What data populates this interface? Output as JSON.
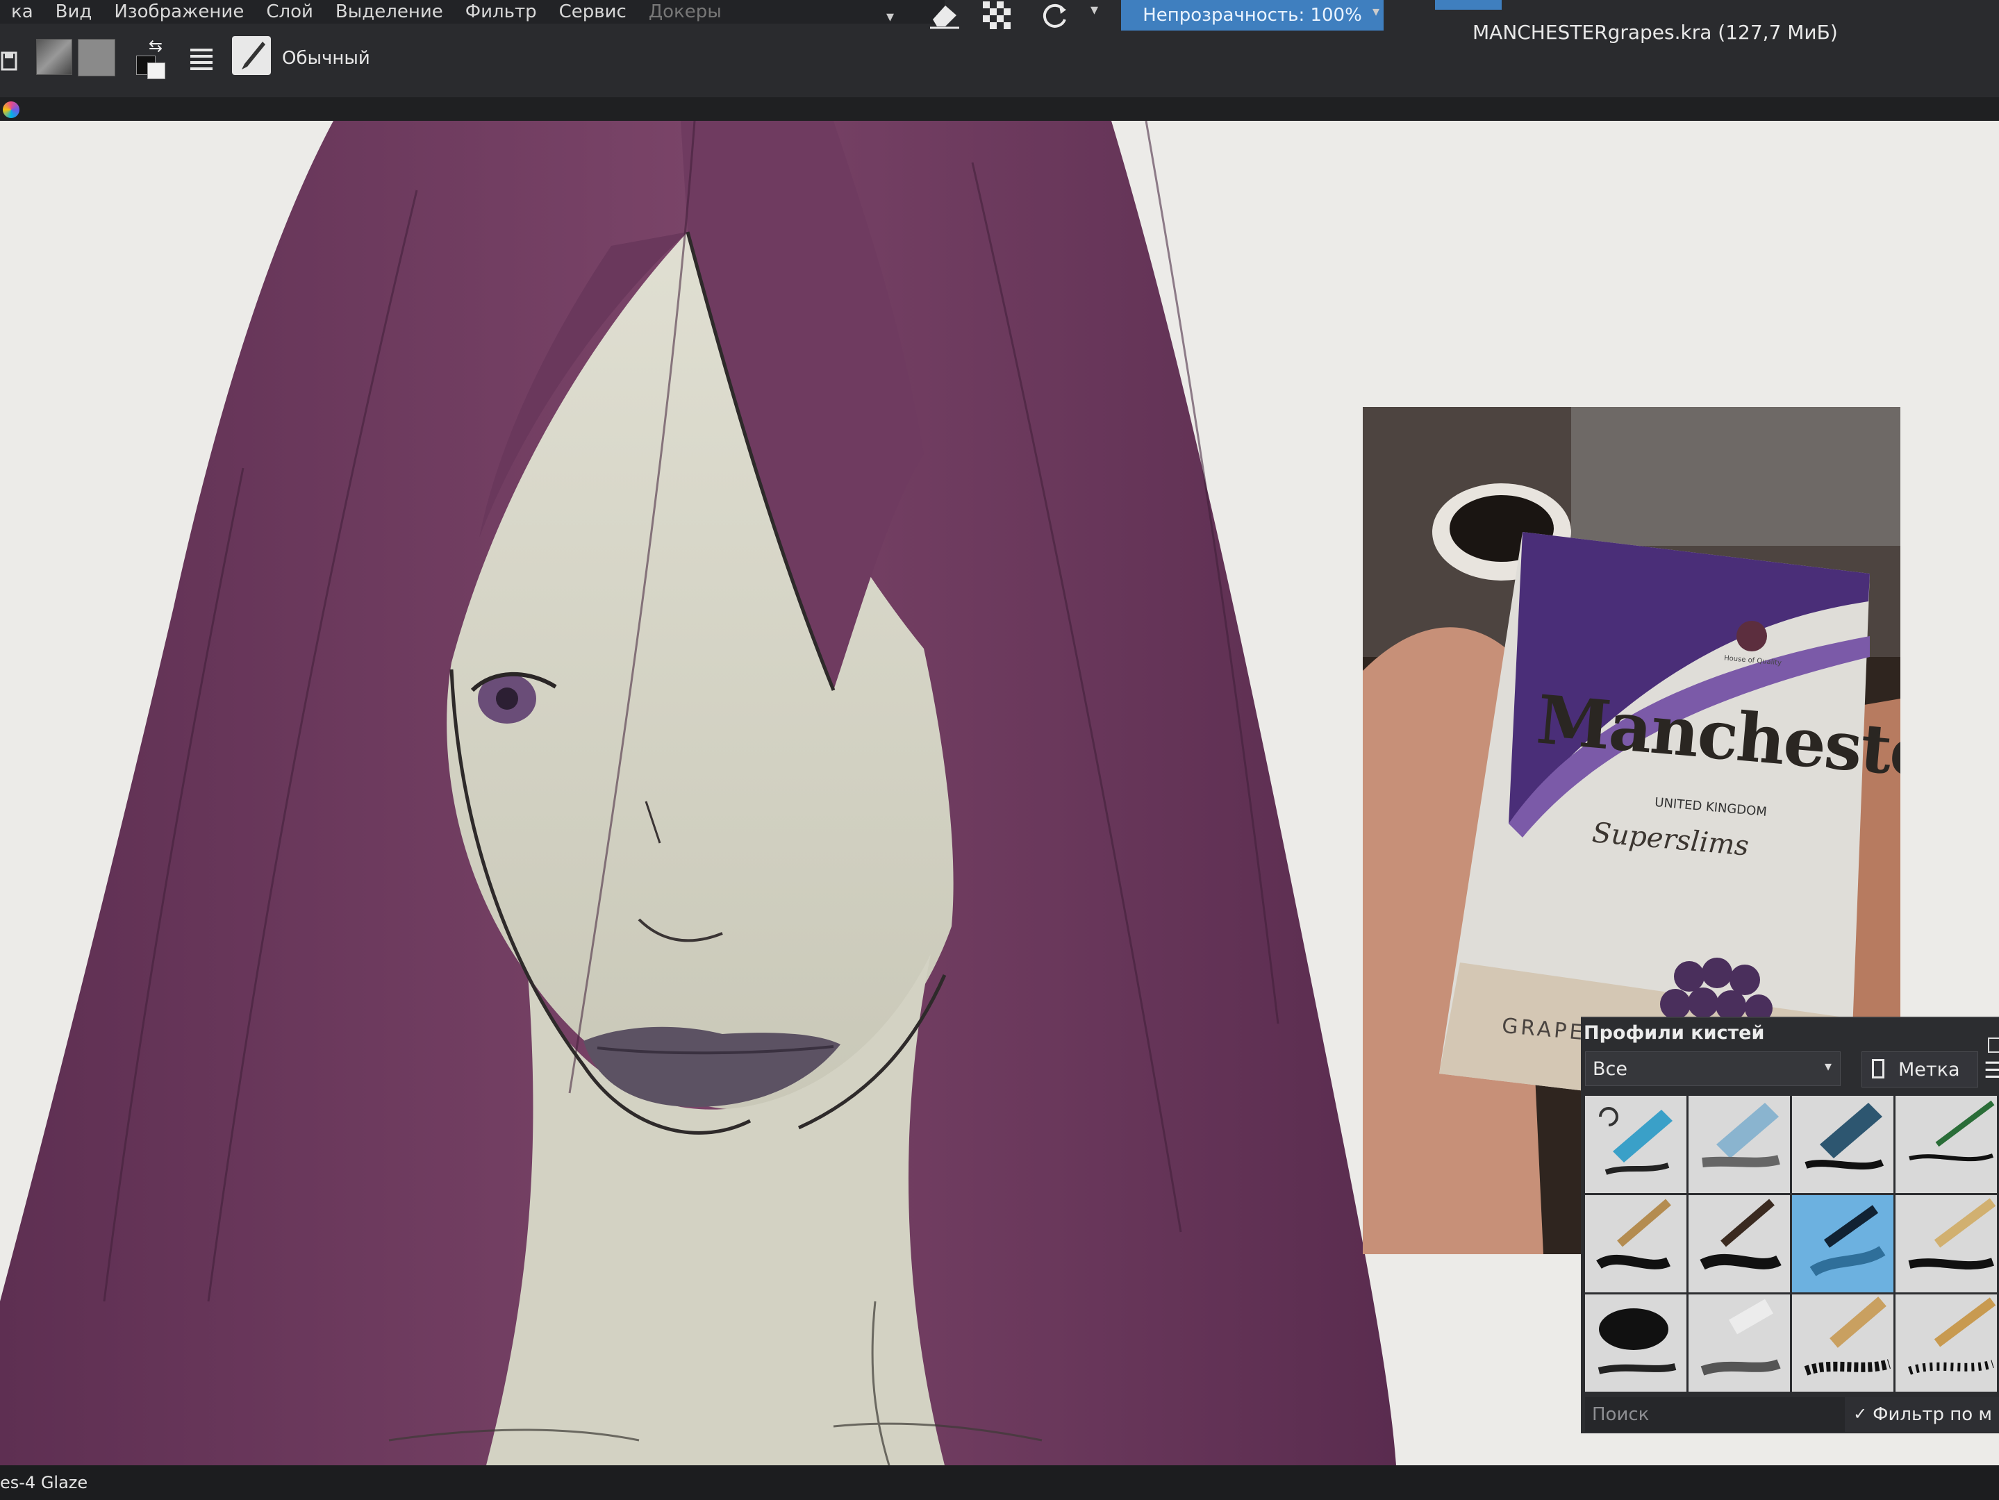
{
  "menu": [
    "ка",
    "Вид",
    "Изображение",
    "Слой",
    "Выделение",
    "Фильтр",
    "Сервис",
    "Докеры"
  ],
  "toolbar": {
    "blend_mode": "Обычный",
    "opacity": "Непрозрачность: 100%"
  },
  "document": {
    "title": "MANCHESTERgrapes.kra (127,7 МиБ)"
  },
  "reference": {
    "brand": "Manchester",
    "country": "UNITED KINGDOM",
    "line": "Superslims",
    "flavor": "GRAPES",
    "crest": "House of Quality"
  },
  "brush_presets": {
    "title": "Профили кистей",
    "filter_all": "Все",
    "tag_label": "Метка",
    "search_placeholder": "Поиск",
    "filter_check": "Фильтр по м"
  },
  "status": {
    "brush_name": "es-4 Glaze"
  },
  "colors": {
    "hair": "#6d3a5d",
    "skin": "#d9d8ca",
    "lips": "#5a4e60",
    "accent": "#3f7fbf",
    "pack_purple": "#4a2e78"
  }
}
